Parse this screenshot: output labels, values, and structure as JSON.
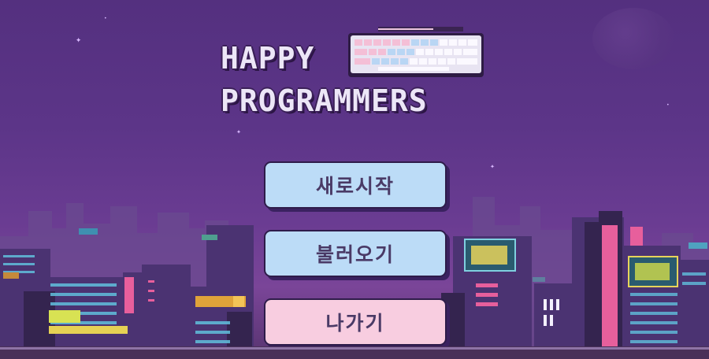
{
  "title": {
    "line1": "HAPPY",
    "line2": "PROGRAMMERS"
  },
  "menu": {
    "new_game": "새로시작",
    "load_game": "불러오기",
    "exit": "나가기"
  },
  "colors": {
    "sky_top": "#54307f",
    "sky_bottom": "#7a4598",
    "button_blue": "#bcdcf7",
    "button_pink": "#f8cde0",
    "title_text": "#ece6f7"
  },
  "icons": [
    "keyboard-icon",
    "moon-icon",
    "star-icon"
  ]
}
